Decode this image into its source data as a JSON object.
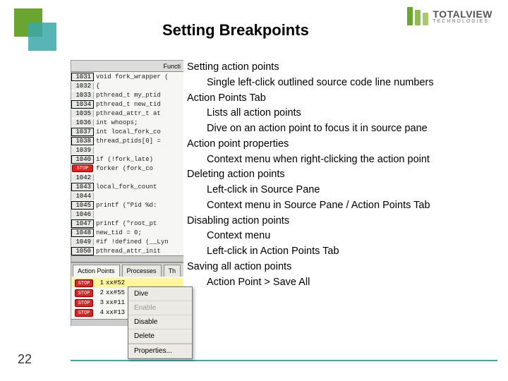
{
  "brand": {
    "main": "TOTALVIEW",
    "sub": "TECHNOLOGIES"
  },
  "title": "Setting  Breakpoints",
  "page_number": "22",
  "bullets": {
    "h1": "Setting action points",
    "h1s1": "Single left-click outlined source code line numbers",
    "h2": "Action Points Tab",
    "h2s1": "Lists all action points",
    "h2s2": "Dive on an action point to focus it in source pane",
    "h3": "Action point properties",
    "h3s1": "Context menu when right-clicking the action point",
    "h4": "Deleting action points",
    "h4s1": "Left-click in Source Pane",
    "h4s2": "Context menu in Source Pane / Action Points Tab",
    "h5": "Disabling action points",
    "h5s1": "Context menu",
    "h5s2": "Left-click in Action Points Tab",
    "h6": "Saving all action points",
    "h6s1": "Action Point > Save All"
  },
  "screenshot": {
    "func_header": "Functi",
    "lines": [
      {
        "n": "1031",
        "code": "void fork_wrapper (",
        "boxed": true
      },
      {
        "n": "1032",
        "code": "{"
      },
      {
        "n": "1033",
        "code": "  pthread_t my_ptid"
      },
      {
        "n": "1034",
        "code": "  pthread_t new_tid",
        "boxed": true
      },
      {
        "n": "1035",
        "code": "  pthread_attr_t at"
      },
      {
        "n": "1036",
        "code": "  int whoops;"
      },
      {
        "n": "1037",
        "code": "  int local_fork_co",
        "boxed": true
      },
      {
        "n": "1038",
        "code": "  thread_ptids[0] =",
        "boxed": true
      },
      {
        "n": "1039",
        "code": ""
      },
      {
        "n": "1040",
        "code": "  if (!fork_late)",
        "boxed": true
      },
      {
        "badge": "stop",
        "n": "",
        "code": "    forker (fork_co"
      },
      {
        "n": "1042",
        "code": ""
      },
      {
        "n": "1043",
        "code": "  local_fork_count",
        "boxed": true
      },
      {
        "n": "1044",
        "code": ""
      },
      {
        "n": "1045",
        "code": "  printf (\"Pid %d:",
        "boxed": true
      },
      {
        "n": "1046",
        "code": ""
      },
      {
        "n": "1047",
        "code": "  printf (\"root_pt",
        "boxed": true
      },
      {
        "n": "1048",
        "code": "  new_tid = 0;",
        "boxed": true
      },
      {
        "n": "1049",
        "code": "#if !defined (__Lyn"
      },
      {
        "n": "1050",
        "code": "  pthread_attr_init",
        "boxed": true
      }
    ],
    "tabs": {
      "t1": "Action Points",
      "t2": "Processes",
      "t3": "Th"
    },
    "ap_rows": [
      {
        "id": "1",
        "txt": "xx#52",
        "sel": true
      },
      {
        "id": "2",
        "txt": "xx#55"
      },
      {
        "id": "3",
        "txt": "xx#11"
      },
      {
        "id": "4",
        "txt": "xx#13"
      }
    ],
    "context_menu": {
      "m1": "Dive",
      "m2": "Enable",
      "m3": "Disable",
      "m4": "Delete",
      "m5": "Properties..."
    }
  }
}
